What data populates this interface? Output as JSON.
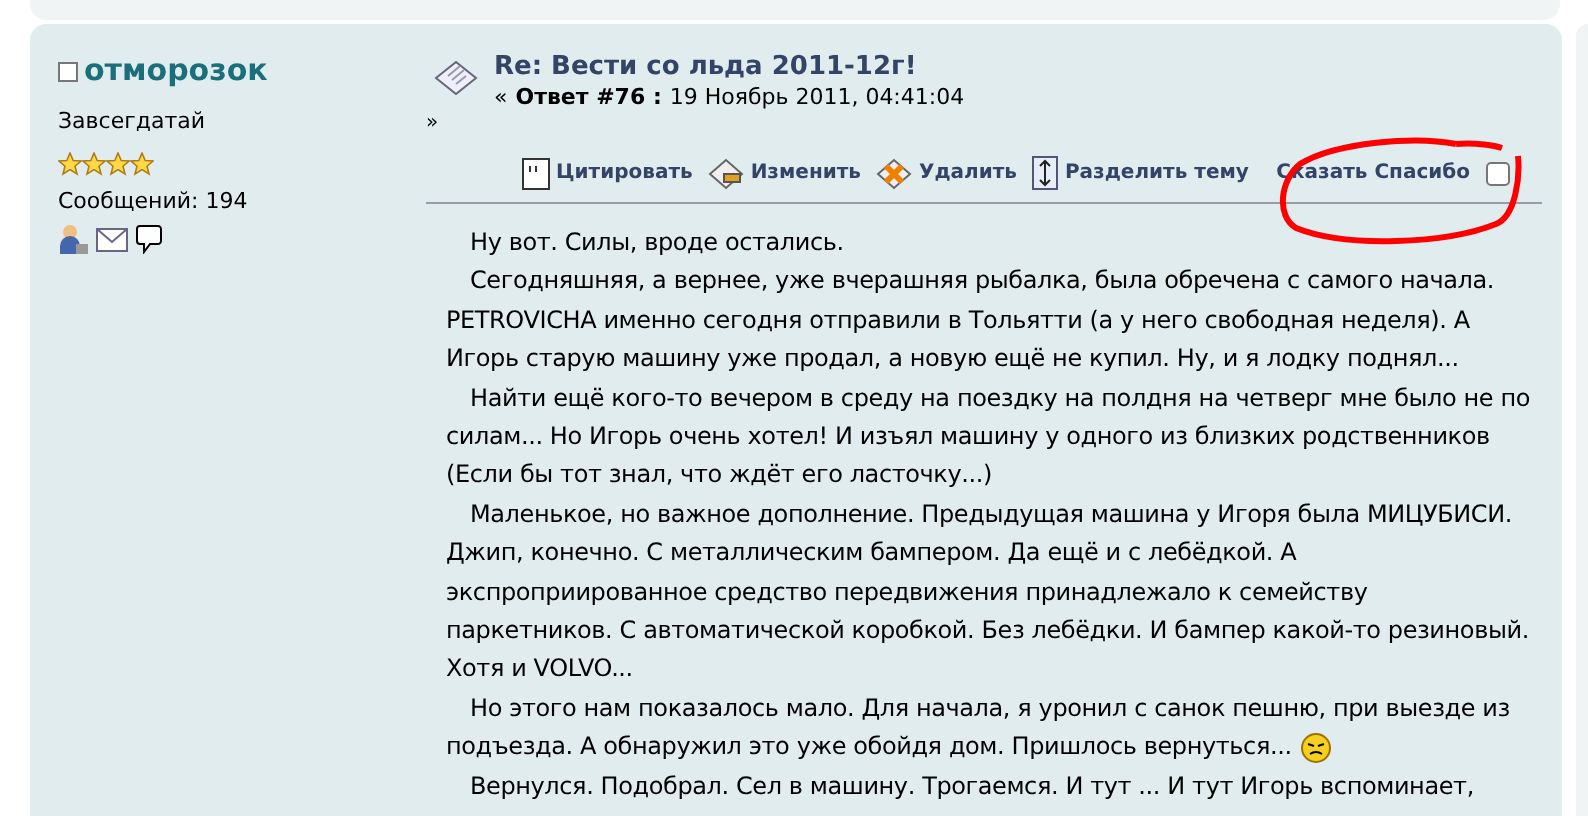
{
  "author": {
    "name": "отморозок",
    "rank": "Завсегдатай",
    "stars": 4,
    "posts": "Сообщений: 194"
  },
  "post": {
    "title": "Re: Вести со льда 2011-12г!",
    "prefix": "«",
    "reply": "Ответ #76 :",
    "date": "19 Ноябрь 2011, 04:41:04",
    "suffix": "»"
  },
  "actions": [
    {
      "label": "Цитировать",
      "kind": "quote"
    },
    {
      "label": "Изменить",
      "kind": "edit"
    },
    {
      "label": "Удалить",
      "kind": "delete"
    },
    {
      "label": "Разделить тему",
      "kind": "split"
    }
  ],
  "thanks": {
    "label": "Сказать Спасибо",
    "checked": false
  },
  "paragraphs": [
    {
      "text": "Ну вот. Силы, вроде остались.",
      "emoticon": false
    },
    {
      "text": "Сегодняшняя, а вернее, уже вчерашняя рыбалка, была обречена с самого начала. PETROVICHA именно сегодня отправили в Тольятти (а у него свободная неделя). А Игорь старую машину уже продал, а новую ещё не купил. Ну, и я лодку поднял...",
      "emoticon": false
    },
    {
      "text": "Найти ещё кого-то вечером в среду на поездку на полдня на четверг мне было не по силам... Но Игорь очень хотел! И изъял машину у одного из близких родственников (Если бы тот знал, что ждёт его ласточку...)",
      "emoticon": false
    },
    {
      "text": "Маленькое, но важное дополнение. Предыдущая машина у Игоря была МИЦУБИСИ. Джип, конечно. С металлическим бампером. Да ещё и с лебёдкой. А экспроприированное средство передвижения принадлежало к семейству паркетников. С автоматической коробкой. Без лебёдки. И бампер какой-то резиновый.  Хотя и VOLVO...",
      "emoticon": false
    },
    {
      "text": "Но этого нам показалось мало. Для начала, я уронил с санок пешню, при выезде из подъезда. А обнаружил это уже обойдя дом. Пришлось вернуться...",
      "emoticon": true
    },
    {
      "text": "Вернулся. Подобрал. Сел в машину. Трогаемся. И тут ... И тут Игорь вспоминает,",
      "emoticon": false
    }
  ]
}
